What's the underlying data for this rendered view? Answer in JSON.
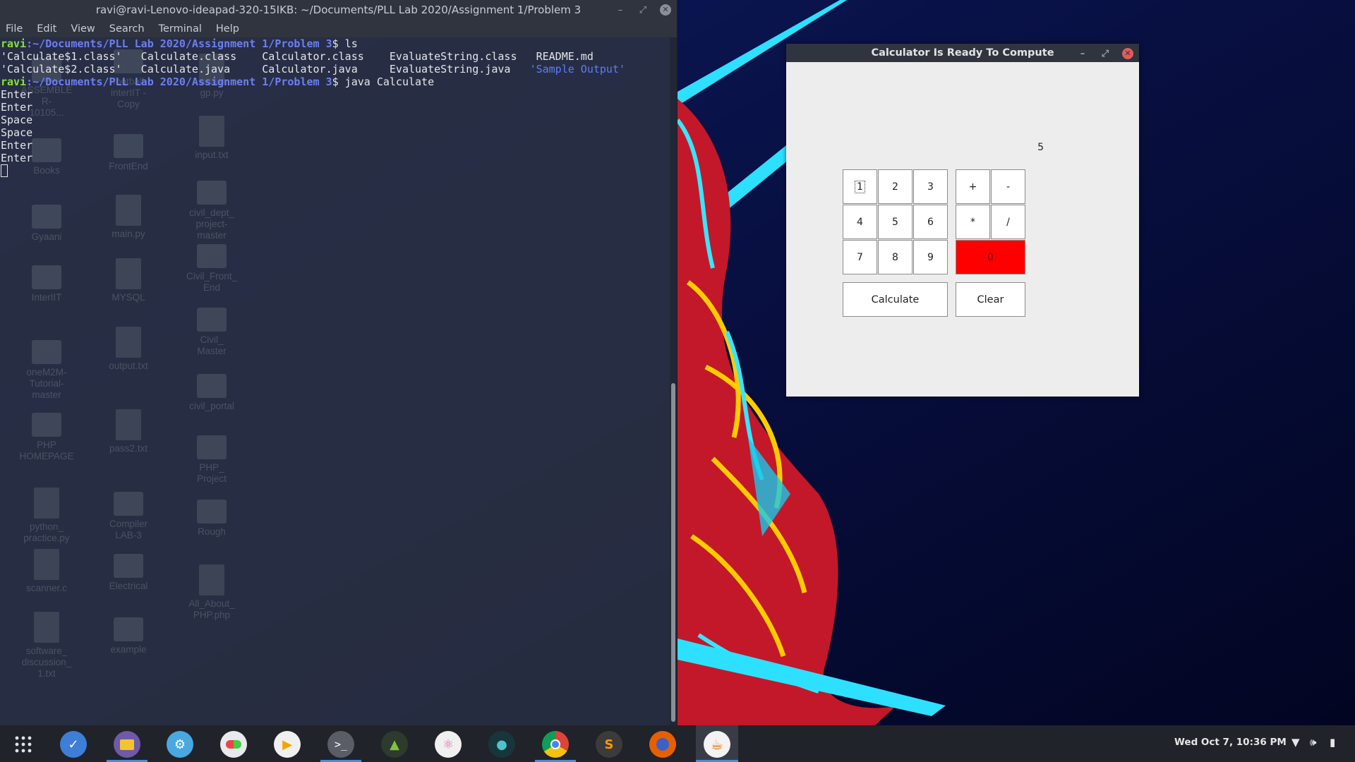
{
  "terminal": {
    "title": "ravi@ravi-Lenovo-ideapad-320-15IKB: ~/Documents/PLL Lab 2020/Assignment 1/Problem 3",
    "menu": [
      "File",
      "Edit",
      "View",
      "Search",
      "Terminal",
      "Help"
    ],
    "prompt_user": "ravi",
    "prompt_path": ":~/Documents/PLL Lab 2020/Assignment 1/Problem 3",
    "command1": "$ ls",
    "ls_row1": "'Calculate$1.class'   Calculate.class    Calculator.class    EvaluateString.class   README.md",
    "ls_row2_plain": "'Calculate$2.class'   Calculate.java     Calculator.java     EvaluateString.java   ",
    "ls_row2_blue": "'Sample Output'",
    "command2": "$ java Calculate",
    "output_lines": [
      "Enter",
      "Enter",
      "Space",
      "Space",
      "Enter",
      "Enter"
    ],
    "window_controls": {
      "minimize": "–",
      "maximize": "⤢",
      "close": "✕"
    }
  },
  "desktop_icons": [
    {
      "label": "ASSEMBLE\nR-\n10105...",
      "type": "folder"
    },
    {
      "label": "football\ninterIIT -\nCopy",
      "type": "folder"
    },
    {
      "label": "gp.py",
      "type": "file"
    },
    {
      "label": "Books",
      "type": "folder"
    },
    {
      "label": "FrontEnd",
      "type": "folder"
    },
    {
      "label": "input.txt",
      "type": "file"
    },
    {
      "label": "Gyaani",
      "type": "folder"
    },
    {
      "label": "main.py",
      "type": "file"
    },
    {
      "label": "civil_dept_\nproject-\nmaster",
      "type": "folder"
    },
    {
      "label": "InterIIT",
      "type": "folder"
    },
    {
      "label": "MYSQL",
      "type": "file"
    },
    {
      "label": "Civil_Front_\nEnd",
      "type": "folder"
    },
    {
      "label": "oneM2M-\nTutorial-\nmaster",
      "type": "folder"
    },
    {
      "label": "output.txt",
      "type": "file"
    },
    {
      "label": "Civil_\nMaster",
      "type": "folder"
    },
    {
      "label": "PHP\nHOMEPAGE",
      "type": "folder"
    },
    {
      "label": "pass2.txt",
      "type": "file"
    },
    {
      "label": "civil_portal",
      "type": "folder"
    },
    {
      "label": "python_\npractice.py",
      "type": "file"
    },
    {
      "label": "Compiler\nLAB-3",
      "type": "folder"
    },
    {
      "label": "PHP_\nProject",
      "type": "folder"
    },
    {
      "label": "scanner.c",
      "type": "file"
    },
    {
      "label": "Electrical",
      "type": "folder"
    },
    {
      "label": "Rough",
      "type": "folder"
    },
    {
      "label": "software_\ndiscussion_\n1.txt",
      "type": "file"
    },
    {
      "label": "example",
      "type": "folder"
    },
    {
      "label": "All_About_\nPHP.php",
      "type": "file"
    }
  ],
  "calculator": {
    "title": "Calculator Is Ready To Compute",
    "display": "5",
    "keys": [
      "1",
      "2",
      "3",
      "+",
      "-",
      "4",
      "5",
      "6",
      "*",
      "/",
      "7",
      "8",
      "9",
      "0"
    ],
    "calculate_label": "Calculate",
    "clear_label": "Clear",
    "window_controls": {
      "minimize": "–",
      "maximize": "⤢",
      "close": "✕"
    },
    "zero_color": "#ff0000"
  },
  "taskbar": {
    "apps": [
      "app-grid-icon",
      "tasks-icon",
      "files-icon",
      "settings-icon",
      "toggle-app-icon",
      "media-player-icon",
      "terminal-icon",
      "android-studio-icon",
      "atom-icon",
      "gitkraken-icon",
      "chrome-icon",
      "sublime-text-icon",
      "firefox-icon",
      "java-icon"
    ],
    "clock": "Wed Oct  7, 10:36 PM"
  }
}
